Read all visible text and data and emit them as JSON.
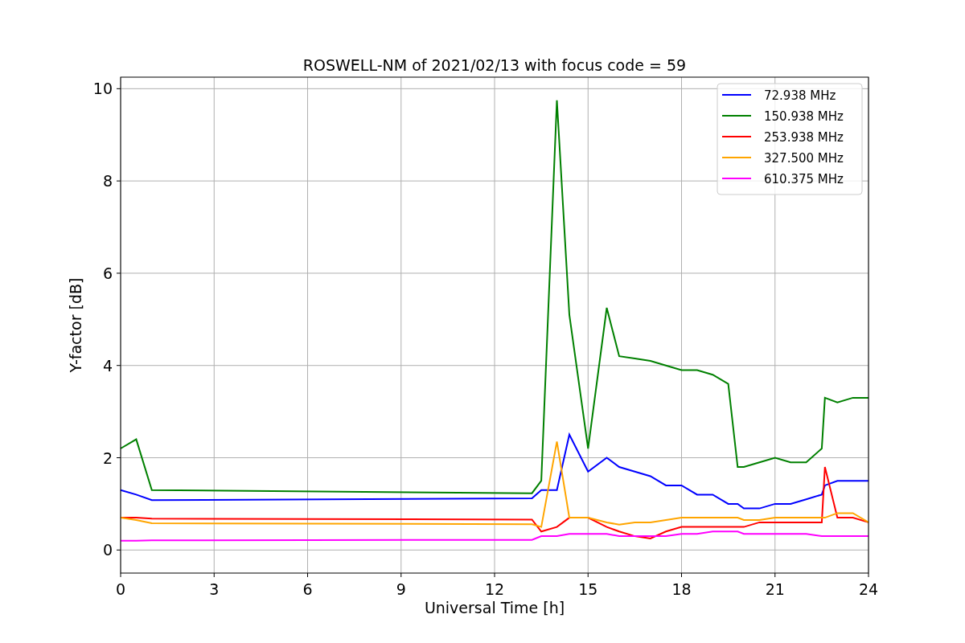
{
  "figure": {
    "chart_data": {
      "type": "line",
      "title": "ROSWELL-NM of 2021/02/13 with focus code = 59",
      "xlabel": "Universal Time [h]",
      "ylabel": "Y-factor [dB]",
      "x": [
        0,
        0.5,
        1,
        13.2,
        13.5,
        14,
        14.4,
        15,
        15.6,
        16,
        16.5,
        17,
        17.5,
        18,
        18.5,
        19,
        19.5,
        19.8,
        20,
        20.5,
        21,
        21.5,
        22,
        22.5,
        22.6,
        23,
        23.5,
        24
      ],
      "series": [
        {
          "name": "72.938 MHz",
          "color": "#0000ff",
          "values": [
            1.3,
            1.2,
            1.08,
            1.12,
            1.3,
            1.3,
            2.5,
            1.7,
            2.0,
            1.8,
            1.7,
            1.6,
            1.4,
            1.4,
            1.2,
            1.2,
            1.0,
            1.0,
            0.9,
            0.9,
            1.0,
            1.0,
            1.1,
            1.2,
            1.4,
            1.5,
            1.5,
            1.5
          ]
        },
        {
          "name": "150.938 MHz",
          "color": "#008000",
          "values": [
            2.2,
            2.4,
            1.3,
            1.23,
            1.5,
            9.75,
            5.1,
            2.2,
            5.25,
            4.2,
            4.15,
            4.1,
            4.0,
            3.9,
            3.9,
            3.8,
            3.6,
            1.8,
            1.8,
            1.9,
            2.0,
            1.9,
            1.9,
            2.2,
            3.3,
            3.2,
            3.3,
            3.3
          ]
        },
        {
          "name": "253.938 MHz",
          "color": "#ff0000",
          "values": [
            0.7,
            0.7,
            0.68,
            0.66,
            0.4,
            0.5,
            0.7,
            0.7,
            0.5,
            0.4,
            0.3,
            0.25,
            0.4,
            0.5,
            0.5,
            0.5,
            0.5,
            0.5,
            0.5,
            0.6,
            0.6,
            0.6,
            0.6,
            0.6,
            1.8,
            0.7,
            0.7,
            0.6
          ]
        },
        {
          "name": "327.500 MHz",
          "color": "#ffa500",
          "values": [
            0.7,
            0.65,
            0.58,
            0.56,
            0.5,
            2.35,
            0.7,
            0.7,
            0.6,
            0.55,
            0.6,
            0.6,
            0.65,
            0.7,
            0.7,
            0.7,
            0.7,
            0.7,
            0.65,
            0.65,
            0.7,
            0.7,
            0.7,
            0.7,
            0.7,
            0.8,
            0.8,
            0.6
          ]
        },
        {
          "name": "610.375 MHz",
          "color": "#ff00ff",
          "values": [
            0.2,
            0.2,
            0.21,
            0.22,
            0.3,
            0.3,
            0.35,
            0.35,
            0.35,
            0.3,
            0.3,
            0.3,
            0.3,
            0.35,
            0.35,
            0.4,
            0.4,
            0.4,
            0.35,
            0.35,
            0.35,
            0.35,
            0.35,
            0.3,
            0.3,
            0.3,
            0.3,
            0.3
          ]
        }
      ],
      "xlim": [
        0,
        24
      ],
      "ylim": [
        -0.5,
        10.25
      ],
      "xticks": [
        0,
        3,
        6,
        9,
        12,
        15,
        18,
        21,
        24
      ],
      "yticks": [
        0,
        2,
        4,
        6,
        8,
        10
      ],
      "grid": true,
      "legend": true
    }
  }
}
